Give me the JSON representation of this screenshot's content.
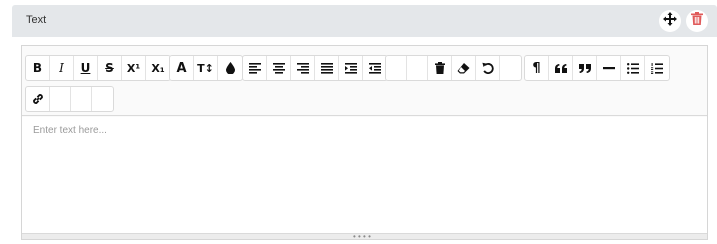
{
  "panel": {
    "title": "Text",
    "actions": [
      {
        "name": "move",
        "icon": "move-arrows-icon"
      },
      {
        "name": "delete",
        "icon": "trash-icon",
        "color": "#e05a5a"
      }
    ]
  },
  "toolbar": {
    "groups": [
      {
        "name": "font-style",
        "buttons": [
          {
            "label": "B",
            "icon": "bold-icon",
            "title": "Bold"
          },
          {
            "label": "I",
            "icon": "italic-icon",
            "title": "Italic"
          },
          {
            "label": "U",
            "icon": "underline-icon",
            "title": "Underline"
          },
          {
            "label": "S",
            "icon": "strikethrough-icon",
            "title": "Strikethrough"
          },
          {
            "label": "X¹",
            "icon": "superscript-icon",
            "title": "Superscript"
          },
          {
            "label": "X₁",
            "icon": "subscript-icon",
            "title": "Subscript"
          }
        ]
      },
      {
        "name": "font",
        "buttons": [
          {
            "label": "A",
            "icon": "font-icon",
            "title": "Font"
          },
          {
            "label": "T↕",
            "icon": "font-size-icon",
            "title": "Font size"
          },
          {
            "label": "",
            "icon": "color-drop-icon",
            "title": "Color"
          }
        ]
      },
      {
        "name": "align",
        "buttons": [
          {
            "icon": "align-left-icon"
          },
          {
            "icon": "align-center-icon"
          },
          {
            "icon": "align-right-icon"
          },
          {
            "icon": "align-justify-icon"
          },
          {
            "icon": "indent-icon"
          },
          {
            "icon": "outdent-icon"
          }
        ]
      },
      {
        "name": "edit",
        "buttons": [
          {
            "icon": "empty-icon"
          },
          {
            "icon": "empty-icon"
          },
          {
            "icon": "trash-icon"
          },
          {
            "icon": "eraser-icon"
          },
          {
            "icon": "undo-icon"
          },
          {
            "icon": "empty-icon"
          }
        ]
      },
      {
        "name": "block",
        "buttons": [
          {
            "label": "¶",
            "icon": "paragraph-icon"
          },
          {
            "icon": "quote-left-icon"
          },
          {
            "icon": "quote-right-icon"
          },
          {
            "icon": "horizontal-rule-icon"
          },
          {
            "icon": "unordered-list-icon"
          },
          {
            "icon": "ordered-list-icon"
          }
        ]
      },
      {
        "name": "insert",
        "buttons": [
          {
            "icon": "link-icon"
          },
          {
            "icon": "empty-icon"
          },
          {
            "icon": "empty-icon"
          },
          {
            "icon": "empty-icon"
          }
        ]
      }
    ]
  },
  "editor": {
    "placeholder": "Enter text here...",
    "resize_grip": "• • • •"
  }
}
